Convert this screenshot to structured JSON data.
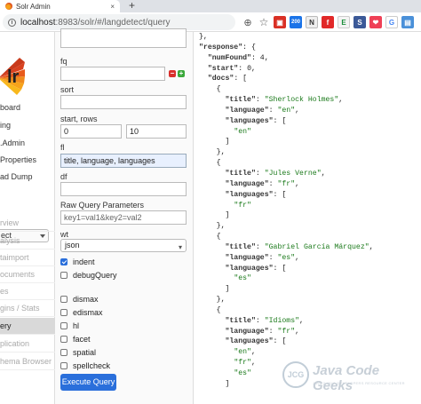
{
  "browser": {
    "tab_title": "Solr Admin",
    "tab_close": "×",
    "new_tab": "+",
    "url_host": "localhost",
    "url_path": ":8983/solr/#/langdetect/query",
    "icons": [
      "zoom-icon",
      "bookmark-star-icon",
      "extension-red-icon",
      "extension-200-icon",
      "extension-n-icon",
      "extension-flipboard-icon",
      "extension-e-icon",
      "extension-s-icon",
      "extension-pocket-icon",
      "extension-g-icon",
      "extension-blue-icon"
    ],
    "icon_labels": {
      "b200": "200",
      "n": "N",
      "e": "E",
      "s": "S",
      "g": "G"
    }
  },
  "solr_nav": {
    "logo_text": "lr",
    "items": [
      "board",
      "ing",
      ".Admin",
      "Properties",
      "ad Dump"
    ],
    "core_selected": "ect",
    "core_items": [
      "rview",
      "alysis",
      "taimport",
      "ocuments",
      "es",
      "gins / Stats",
      "ery",
      "plication",
      "hema Browser"
    ],
    "active_core_item": "ery"
  },
  "form": {
    "fq_label": "fq",
    "sort_label": "sort",
    "start_rows_label": "start, rows",
    "start_value": "0",
    "rows_value": "10",
    "fl_label": "fl",
    "fl_value": "title, language, languages",
    "df_label": "df",
    "raw_label": "Raw Query Parameters",
    "raw_placeholder": "key1=val1&key2=val2",
    "wt_label": "wt",
    "wt_value": "json",
    "indent_label": "indent",
    "debug_label": "debugQuery",
    "dismax_label": "dismax",
    "edismax_label": "edismax",
    "hl_label": "hl",
    "facet_label": "facet",
    "spatial_label": "spatial",
    "spellcheck_label": "spellcheck",
    "execute_label": "Execute Query",
    "minus": "−",
    "plus": "+"
  },
  "response": {
    "lines": [
      "},",
      "\"response\": {",
      "  \"numFound\": 4,",
      "  \"start\": 0,",
      "  \"docs\": [",
      "    {",
      "      \"title\": \"Sherlock Holmes\",",
      "      \"language\": \"en\",",
      "      \"languages\": [",
      "        \"en\"",
      "      ]",
      "    },",
      "    {",
      "      \"title\": \"Jules Verne\",",
      "      \"language\": \"fr\",",
      "      \"languages\": [",
      "        \"fr\"",
      "      ]",
      "    },",
      "    {",
      "      \"title\": \"Gabriel García Márquez\",",
      "      \"language\": \"es\",",
      "      \"languages\": [",
      "        \"es\"",
      "      ]",
      "    },",
      "    {",
      "      \"title\": \"Idioms\",",
      "      \"language\": \"fr\",",
      "      \"languages\": [",
      "        \"en\",",
      "        \"fr\",",
      "        \"es\"",
      "      ]"
    ]
  },
  "watermark": {
    "badge": "JCG",
    "brand": "Java Code Geeks",
    "tagline": "JAVA 2 JAVA DEVELOPERS RESOURCE CENTER"
  }
}
